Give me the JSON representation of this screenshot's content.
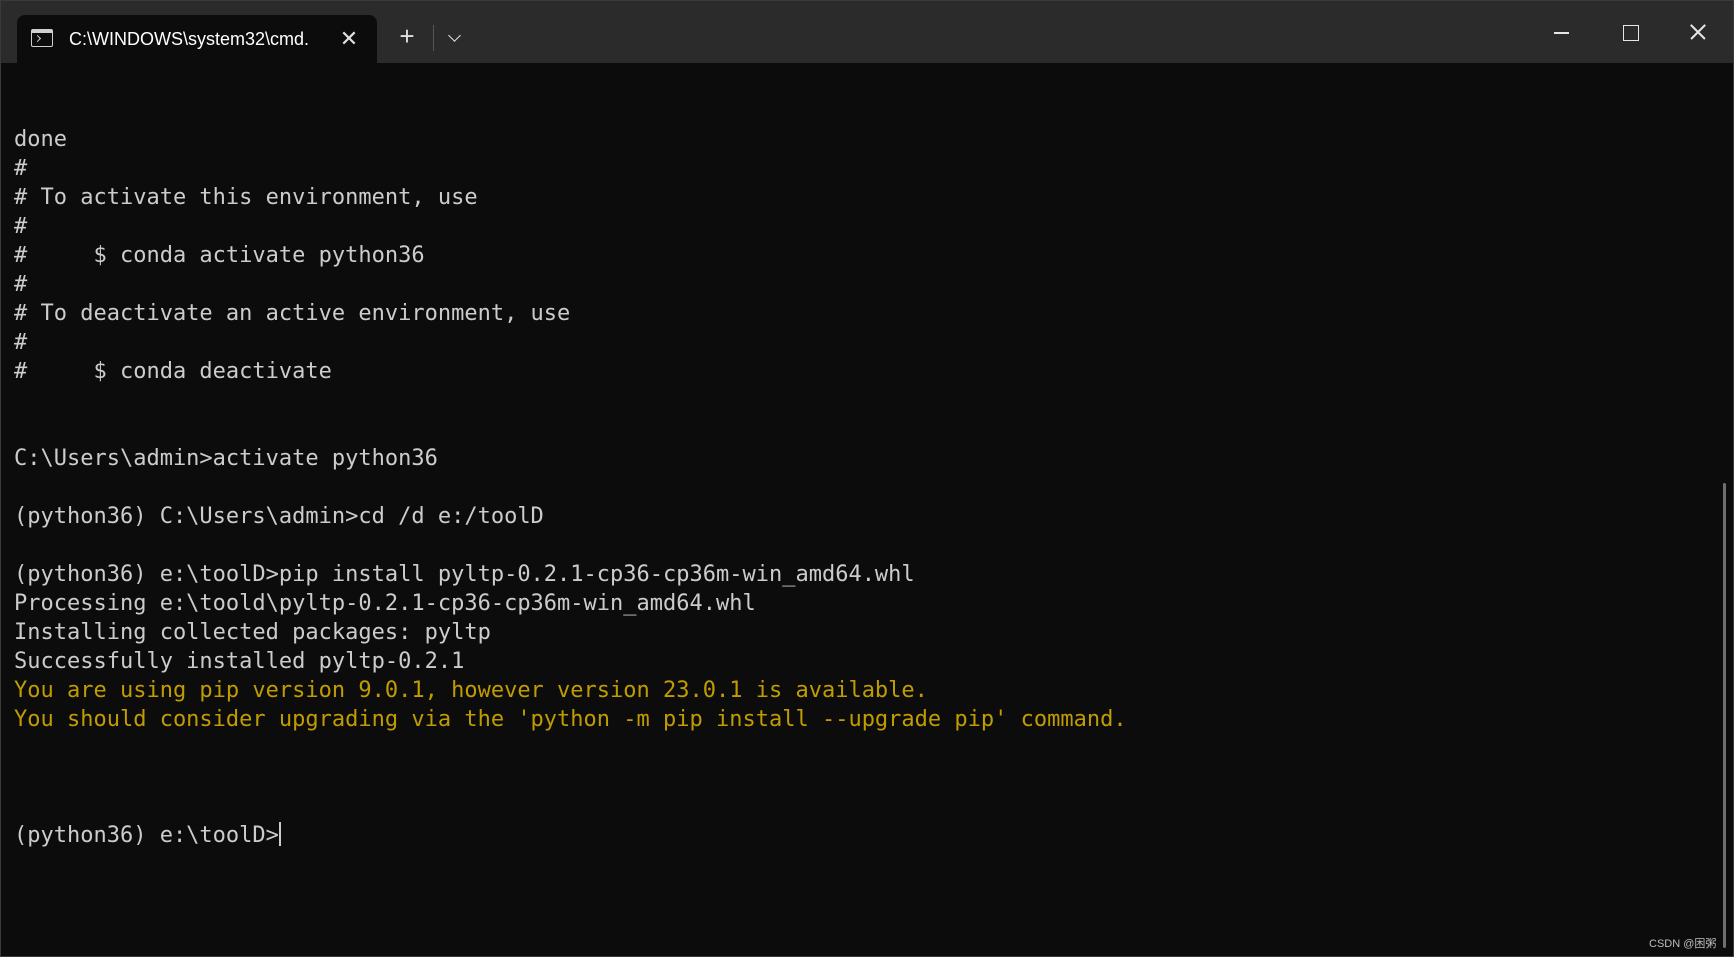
{
  "tab": {
    "title": "C:\\WINDOWS\\system32\\cmd.",
    "close_glyph": "✕"
  },
  "titlebar": {
    "new_tab_glyph": "+"
  },
  "terminal": {
    "lines": [
      {
        "text": "done",
        "style": "normal"
      },
      {
        "text": "#",
        "style": "normal"
      },
      {
        "text": "# To activate this environment, use",
        "style": "normal"
      },
      {
        "text": "#",
        "style": "normal"
      },
      {
        "text": "#     $ conda activate python36",
        "style": "normal"
      },
      {
        "text": "#",
        "style": "normal"
      },
      {
        "text": "# To deactivate an active environment, use",
        "style": "normal"
      },
      {
        "text": "#",
        "style": "normal"
      },
      {
        "text": "#     $ conda deactivate",
        "style": "normal"
      },
      {
        "text": "",
        "style": "normal"
      },
      {
        "text": "",
        "style": "normal"
      },
      {
        "text": "C:\\Users\\admin>activate python36",
        "style": "normal"
      },
      {
        "text": "",
        "style": "normal"
      },
      {
        "text": "(python36) C:\\Users\\admin>cd /d e:/toolD",
        "style": "normal"
      },
      {
        "text": "",
        "style": "normal"
      },
      {
        "text": "(python36) e:\\toolD>pip install pyltp-0.2.1-cp36-cp36m-win_amd64.whl",
        "style": "normal"
      },
      {
        "text": "Processing e:\\toold\\pyltp-0.2.1-cp36-cp36m-win_amd64.whl",
        "style": "normal"
      },
      {
        "text": "Installing collected packages: pyltp",
        "style": "normal"
      },
      {
        "text": "Successfully installed pyltp-0.2.1",
        "style": "normal"
      },
      {
        "text": "You are using pip version 9.0.1, however version 23.0.1 is available.",
        "style": "warn"
      },
      {
        "text": "You should consider upgrading via the 'python -m pip install --upgrade pip' command.",
        "style": "warn"
      },
      {
        "text": "",
        "style": "normal"
      }
    ],
    "prompt": "(python36) e:\\toolD>"
  },
  "watermark": "CSDN @困粥",
  "colors": {
    "background": "#0c0c0c",
    "titlebar": "#2b2b2b",
    "text": "#cccccc",
    "warning": "#c19c00"
  }
}
